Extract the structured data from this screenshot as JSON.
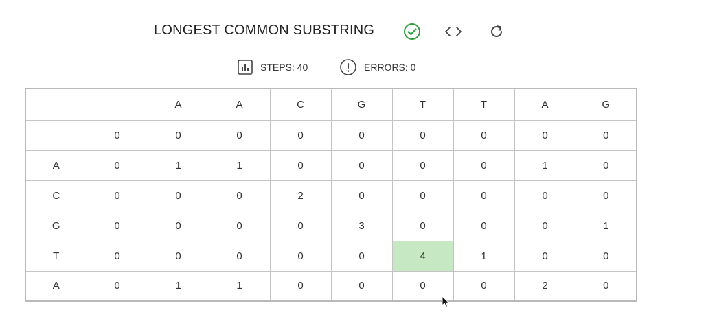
{
  "header": {
    "title": "LONGEST COMMON SUBSTRING",
    "icons": {
      "status": "check-circle-icon",
      "code": "code-brackets-icon",
      "reset": "refresh-icon"
    },
    "success_color": "#2e9e3a"
  },
  "stats": {
    "steps_label": "STEPS: 40",
    "errors_label": "ERRORS: 0",
    "steps_icon": "bar-chart-icon",
    "errors_icon": "alert-circle-icon"
  },
  "table": {
    "column_headers": [
      "",
      "",
      "A",
      "A",
      "C",
      "G",
      "T",
      "T",
      "A",
      "G"
    ],
    "rows": [
      [
        "",
        "0",
        "0",
        "0",
        "0",
        "0",
        "0",
        "0",
        "0",
        "0"
      ],
      [
        "A",
        "0",
        "1",
        "1",
        "0",
        "0",
        "0",
        "0",
        "1",
        "0"
      ],
      [
        "C",
        "0",
        "0",
        "0",
        "2",
        "0",
        "0",
        "0",
        "0",
        "0"
      ],
      [
        "G",
        "0",
        "0",
        "0",
        "0",
        "3",
        "0",
        "0",
        "0",
        "1"
      ],
      [
        "T",
        "0",
        "0",
        "0",
        "0",
        "0",
        "4",
        "1",
        "0",
        "0"
      ],
      [
        "A",
        "0",
        "1",
        "1",
        "0",
        "0",
        "0",
        "0",
        "2",
        "0"
      ]
    ],
    "highlighted_cell": {
      "row": 4,
      "col": 6
    },
    "highlight_color": "#c6e8c2"
  }
}
